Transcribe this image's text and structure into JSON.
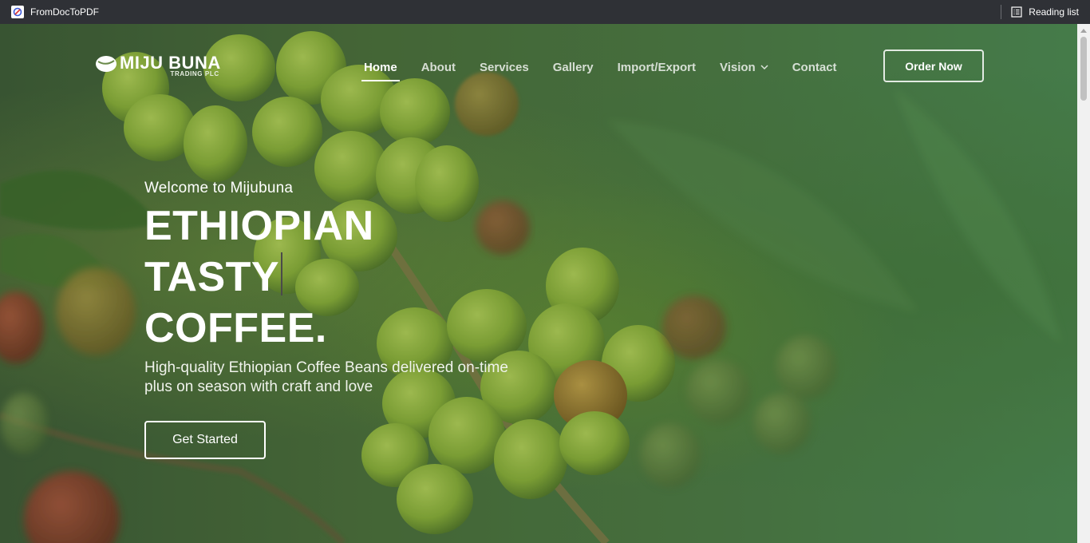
{
  "browser": {
    "bookmark_label": "FromDocToPDF",
    "reading_list_label": "Reading list"
  },
  "site": {
    "logo_name": "MIJU BUNA",
    "logo_sub": "TRADING PLC",
    "nav": [
      {
        "label": "Home",
        "active": true
      },
      {
        "label": "About"
      },
      {
        "label": "Services"
      },
      {
        "label": "Gallery"
      },
      {
        "label": "Import/Export"
      },
      {
        "label": "Vision"
      },
      {
        "label": "Contact"
      }
    ],
    "order_button": "Order Now"
  },
  "hero": {
    "welcome": "Welcome to Mijubuna",
    "title_lines": [
      "ETHIOPIAN",
      "TASTY",
      "COFFEE."
    ],
    "description_line1": "High-quality Ethiopian Coffee Beans delivered on-time",
    "description_line2": "plus on season with craft and love",
    "cta": "Get Started"
  },
  "colors": {
    "browser_bar": "#2f3136",
    "bean_green": "#8fb23a",
    "bean_red": "#b52a24",
    "background_green": "#4f7a46"
  }
}
